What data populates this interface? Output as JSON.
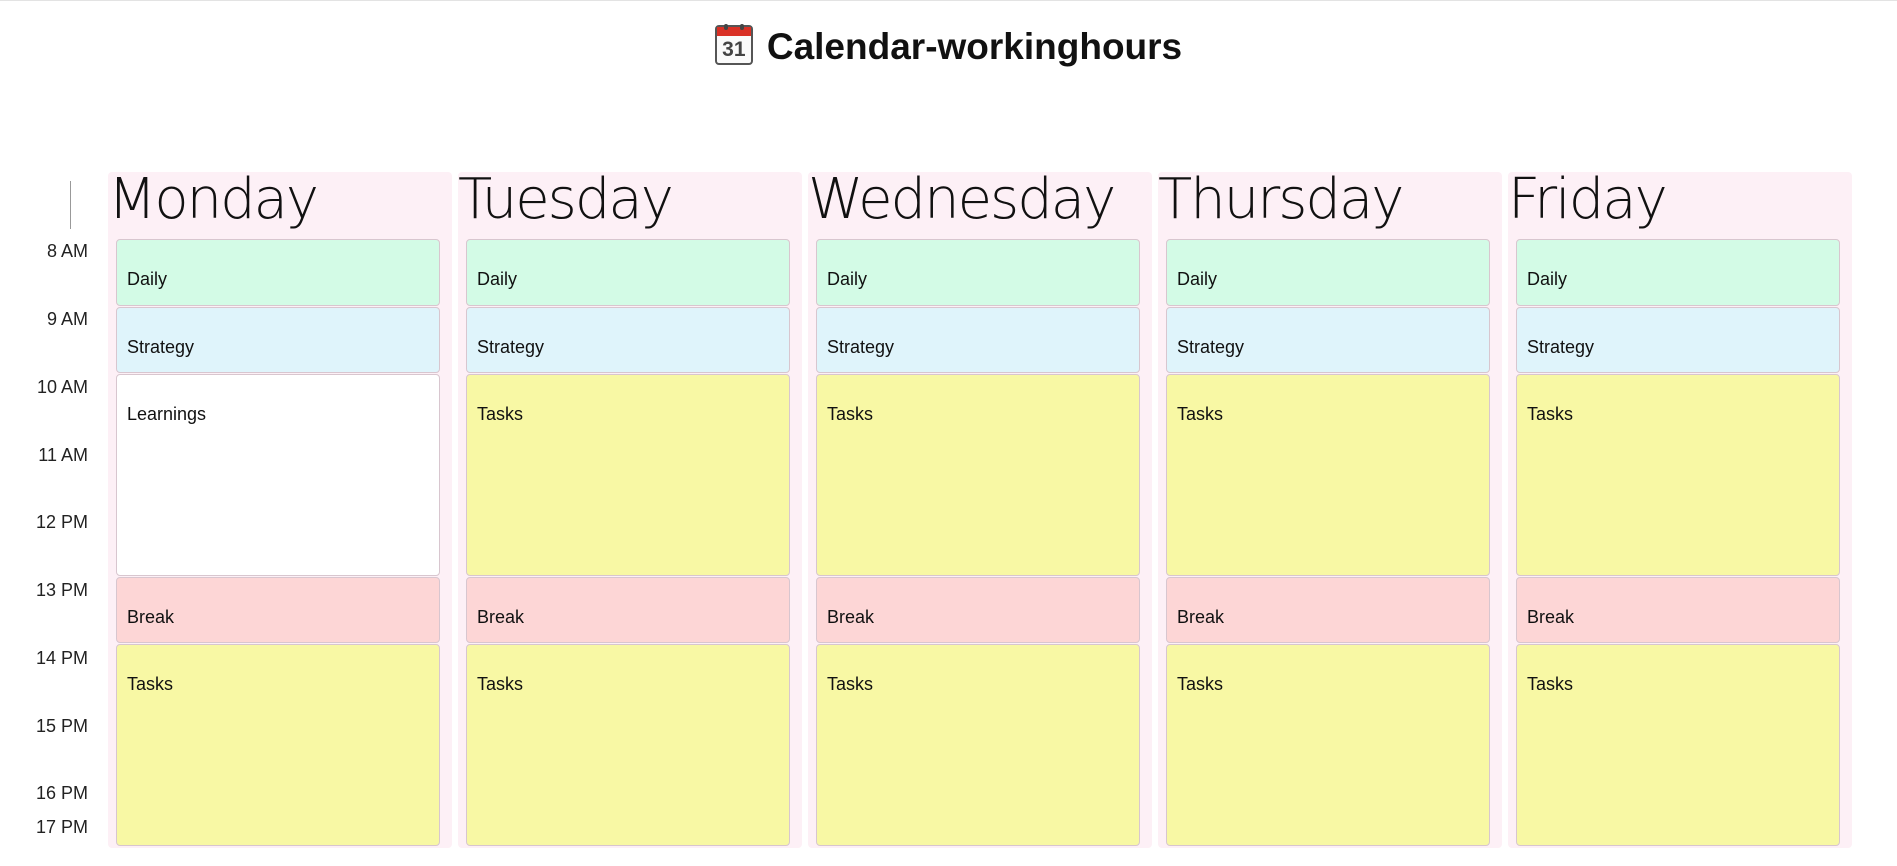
{
  "page": {
    "title": "Calendar-workinghours",
    "title_icon": "calendar-icon",
    "icon_number": "31"
  },
  "time_labels": [
    "8 AM",
    "9 AM",
    "10 AM",
    "11 AM",
    "12 PM",
    "13 PM",
    "14 PM",
    "15 PM",
    "16 PM",
    "17 PM"
  ],
  "days": [
    {
      "name": "Monday",
      "events": [
        {
          "label": "Daily",
          "kind": "daily",
          "start": "8 AM",
          "end": "9 AM"
        },
        {
          "label": "Strategy",
          "kind": "strategy",
          "start": "9 AM",
          "end": "10 AM"
        },
        {
          "label": "Learnings",
          "kind": "learnings",
          "start": "10 AM",
          "end": "13 PM"
        },
        {
          "label": "Break",
          "kind": "break",
          "start": "13 PM",
          "end": "14 PM"
        },
        {
          "label": "Tasks",
          "kind": "tasks",
          "start": "14 PM",
          "end": "17 PM"
        }
      ]
    },
    {
      "name": "Tuesday",
      "events": [
        {
          "label": "Daily",
          "kind": "daily",
          "start": "8 AM",
          "end": "9 AM"
        },
        {
          "label": "Strategy",
          "kind": "strategy",
          "start": "9 AM",
          "end": "10 AM"
        },
        {
          "label": "Tasks",
          "kind": "tasks",
          "start": "10 AM",
          "end": "13 PM"
        },
        {
          "label": "Break",
          "kind": "break",
          "start": "13 PM",
          "end": "14 PM"
        },
        {
          "label": "Tasks",
          "kind": "tasks",
          "start": "14 PM",
          "end": "17 PM"
        }
      ]
    },
    {
      "name": "Wednesday",
      "events": [
        {
          "label": "Daily",
          "kind": "daily",
          "start": "8 AM",
          "end": "9 AM"
        },
        {
          "label": "Strategy",
          "kind": "strategy",
          "start": "9 AM",
          "end": "10 AM"
        },
        {
          "label": "Tasks",
          "kind": "tasks",
          "start": "10 AM",
          "end": "13 PM"
        },
        {
          "label": "Break",
          "kind": "break",
          "start": "13 PM",
          "end": "14 PM"
        },
        {
          "label": "Tasks",
          "kind": "tasks",
          "start": "14 PM",
          "end": "17 PM"
        }
      ]
    },
    {
      "name": "Thursday",
      "events": [
        {
          "label": "Daily",
          "kind": "daily",
          "start": "8 AM",
          "end": "9 AM"
        },
        {
          "label": "Strategy",
          "kind": "strategy",
          "start": "9 AM",
          "end": "10 AM"
        },
        {
          "label": "Tasks",
          "kind": "tasks",
          "start": "10 AM",
          "end": "13 PM"
        },
        {
          "label": "Break",
          "kind": "break",
          "start": "13 PM",
          "end": "14 PM"
        },
        {
          "label": "Tasks",
          "kind": "tasks",
          "start": "14 PM",
          "end": "17 PM"
        }
      ]
    },
    {
      "name": "Friday",
      "events": [
        {
          "label": "Daily",
          "kind": "daily",
          "start": "8 AM",
          "end": "9 AM"
        },
        {
          "label": "Strategy",
          "kind": "strategy",
          "start": "9 AM",
          "end": "10 AM"
        },
        {
          "label": "Tasks",
          "kind": "tasks",
          "start": "10 AM",
          "end": "13 PM"
        },
        {
          "label": "Break",
          "kind": "break",
          "start": "13 PM",
          "end": "14 PM"
        },
        {
          "label": "Tasks",
          "kind": "tasks",
          "start": "14 PM",
          "end": "17 PM"
        }
      ]
    }
  ],
  "colors": {
    "daily": "#d3fbe6",
    "strategy": "#dff4fb",
    "tasks": "#f8f8a4",
    "break": "#fdd6d6",
    "learnings": "#ffffff",
    "day_column": "#fdf0f6"
  }
}
